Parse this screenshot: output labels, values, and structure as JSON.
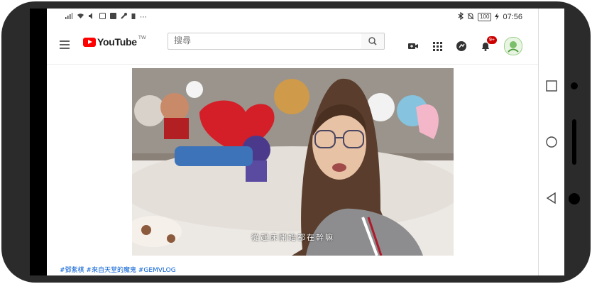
{
  "status_bar": {
    "time": "07:56",
    "battery": "100"
  },
  "header": {
    "logo_text": "YouTube",
    "country": "TW",
    "search_placeholder": "搜尋",
    "notifications_count": "9+"
  },
  "video": {
    "subtitle": "從起床開始都在幹嘛"
  },
  "description": {
    "hashtags": "#鄧紫棋 #來自天堂的魔鬼 #GEMVLOG"
  },
  "colors": {
    "brand_red": "#ff0000",
    "link_blue": "#065fd4"
  }
}
